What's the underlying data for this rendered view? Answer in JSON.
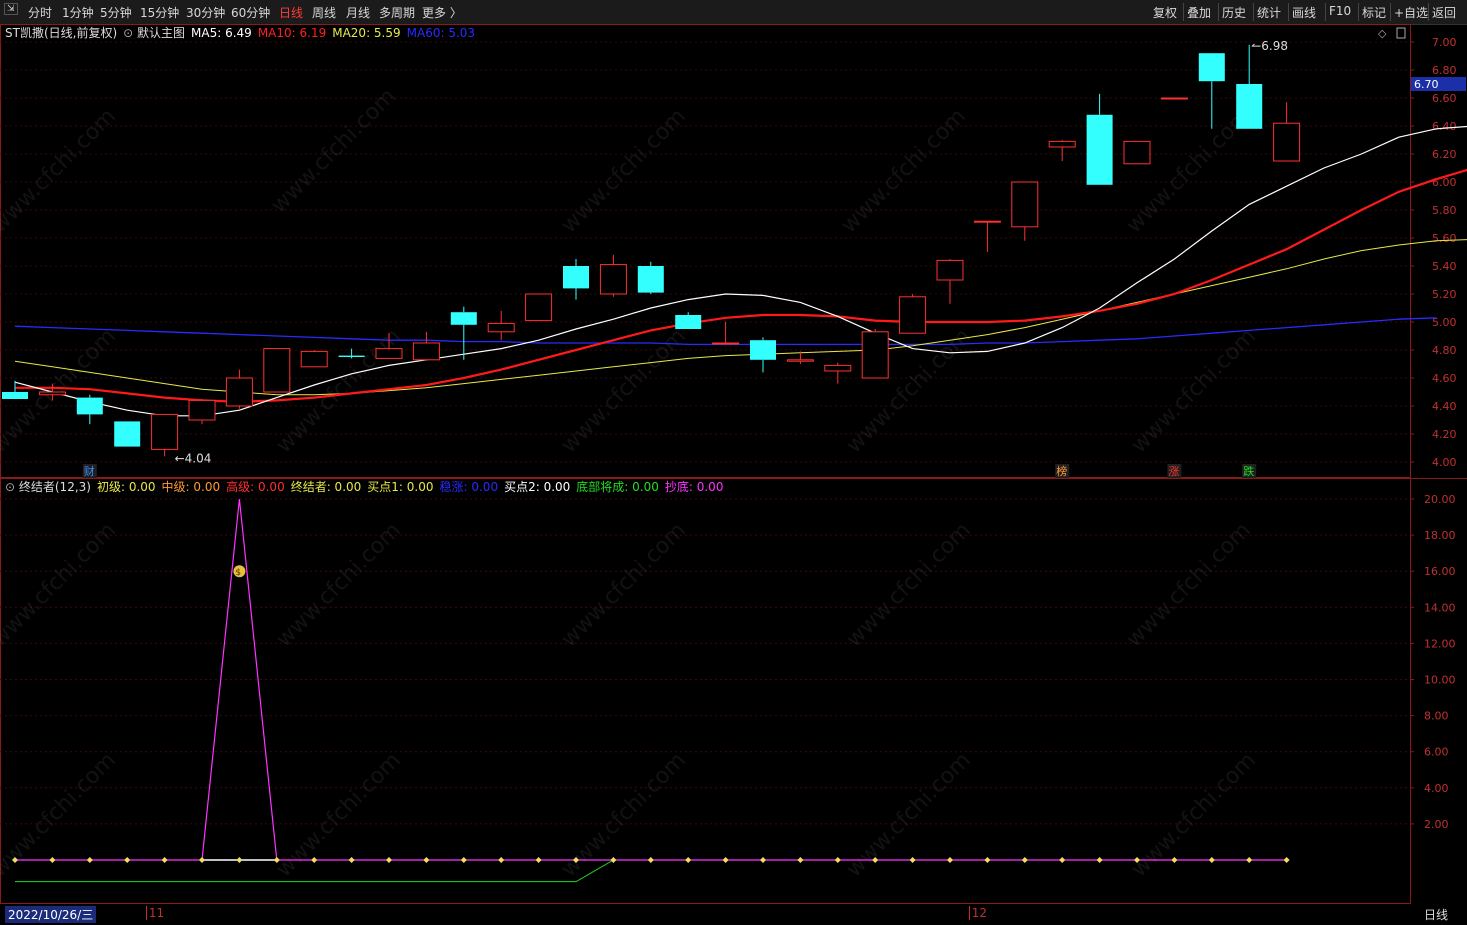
{
  "toolbar": {
    "left": [
      "分时",
      "1分钟",
      "5分钟",
      "15分钟",
      "30分钟",
      "60分钟",
      "日线",
      "周线",
      "月线",
      "多周期",
      "更多 〉"
    ],
    "active": "日线",
    "right": [
      "复权",
      "叠加",
      "历史",
      "统计",
      "画线",
      "F10",
      "标记",
      "+自选",
      "返回"
    ]
  },
  "main_header": {
    "stock": "ST凯撒(日线,前复权)",
    "template": "默认主图",
    "ma": [
      {
        "label": "MA5: 6.49",
        "color": "#ffffff"
      },
      {
        "label": "MA10: 6.19",
        "color": "#ff2020"
      },
      {
        "label": "MA20: 5.59",
        "color": "#e8e84a"
      },
      {
        "label": "MA60: 5.03",
        "color": "#2a2aff"
      }
    ]
  },
  "sub_header": {
    "name": "终结者(12,3)",
    "items": [
      {
        "label": "初级: 0.00",
        "color": "#e8e84a"
      },
      {
        "label": "中级: 0.00",
        "color": "#ff9933"
      },
      {
        "label": "高级: 0.00",
        "color": "#ff3030"
      },
      {
        "label": "终结者: 0.00",
        "color": "#e8e84a"
      },
      {
        "label": "买点1: 0.00",
        "color": "#e8e84a"
      },
      {
        "label": "稳涨: 0.00",
        "color": "#2a2aff"
      },
      {
        "label": "买点2: 0.00",
        "color": "#ffffff"
      },
      {
        "label": "底部将成: 0.00",
        "color": "#22dd22"
      },
      {
        "label": "抄底: 0.00",
        "color": "#ff33ff"
      }
    ]
  },
  "price_axis": {
    "ticks": [
      "7.00",
      "6.80",
      "6.60",
      "6.40",
      "6.20",
      "6.00",
      "5.80",
      "5.60",
      "5.40",
      "5.20",
      "5.00",
      "4.80",
      "4.60",
      "4.40",
      "4.20",
      "4.00"
    ],
    "current_price": "6.70",
    "min": 4.0,
    "max": 7.0
  },
  "sub_axis": {
    "ticks": [
      "20.00",
      "18.00",
      "16.00",
      "14.00",
      "12.00",
      "10.00",
      "8.00",
      "6.00",
      "4.00",
      "2.00"
    ],
    "min": 0,
    "max": 20
  },
  "annotations": {
    "high_label": "6.98",
    "low_label": "4.04",
    "markers": [
      {
        "text": "财",
        "color": "#3a8aff",
        "index": 2
      },
      {
        "text": "榜",
        "color": "#ff9933",
        "index": 28
      },
      {
        "text": "涨",
        "color": "#ff3030",
        "index": 31
      },
      {
        "text": "跌",
        "color": "#22dd22",
        "index": 33
      }
    ]
  },
  "bottom": {
    "date": "2022/10/26/三",
    "month_labels": [
      {
        "text": "11",
        "index": 4
      },
      {
        "text": "12",
        "index": 26
      }
    ],
    "period": "日线"
  },
  "watermark": "www.cfchi.com",
  "chart_data": {
    "type": "candlestick",
    "candles": [
      {
        "o": 4.5,
        "h": 4.58,
        "l": 4.46,
        "c": 4.45
      },
      {
        "o": 4.48,
        "h": 4.56,
        "l": 4.44,
        "c": 4.5
      },
      {
        "o": 4.46,
        "h": 4.48,
        "l": 4.27,
        "c": 4.34
      },
      {
        "o": 4.29,
        "h": 4.29,
        "l": 4.11,
        "c": 4.11
      },
      {
        "o": 4.09,
        "h": 4.34,
        "l": 4.04,
        "c": 4.34
      },
      {
        "o": 4.3,
        "h": 4.45,
        "l": 4.27,
        "c": 4.44
      },
      {
        "o": 4.4,
        "h": 4.66,
        "l": 4.38,
        "c": 4.6
      },
      {
        "o": 4.5,
        "h": 4.81,
        "l": 4.5,
        "c": 4.81
      },
      {
        "o": 4.68,
        "h": 4.8,
        "l": 4.68,
        "c": 4.79
      },
      {
        "o": 4.76,
        "h": 4.81,
        "l": 4.74,
        "c": 4.75
      },
      {
        "o": 4.74,
        "h": 4.92,
        "l": 4.74,
        "c": 4.81
      },
      {
        "o": 4.73,
        "h": 4.93,
        "l": 4.73,
        "c": 4.85
      },
      {
        "o": 5.07,
        "h": 5.11,
        "l": 4.73,
        "c": 4.98
      },
      {
        "o": 4.93,
        "h": 5.08,
        "l": 4.87,
        "c": 4.99
      },
      {
        "o": 5.01,
        "h": 5.2,
        "l": 5.01,
        "c": 5.2
      },
      {
        "o": 5.4,
        "h": 5.45,
        "l": 5.16,
        "c": 5.24
      },
      {
        "o": 5.2,
        "h": 5.48,
        "l": 5.18,
        "c": 5.41
      },
      {
        "o": 5.4,
        "h": 5.43,
        "l": 5.2,
        "c": 5.21
      },
      {
        "o": 5.05,
        "h": 5.07,
        "l": 4.95,
        "c": 4.95
      },
      {
        "o": 4.85,
        "h": 5.0,
        "l": 4.84,
        "c": 4.85
      },
      {
        "o": 4.87,
        "h": 4.89,
        "l": 4.64,
        "c": 4.73
      },
      {
        "o": 4.72,
        "h": 4.79,
        "l": 4.7,
        "c": 4.73
      },
      {
        "o": 4.65,
        "h": 4.71,
        "l": 4.56,
        "c": 4.69
      },
      {
        "o": 4.6,
        "h": 4.95,
        "l": 4.6,
        "c": 4.93
      },
      {
        "o": 4.92,
        "h": 5.2,
        "l": 4.92,
        "c": 5.18
      },
      {
        "o": 5.3,
        "h": 5.45,
        "l": 5.13,
        "c": 5.44
      },
      {
        "o": 5.72,
        "h": 5.72,
        "l": 5.5,
        "c": 5.72
      },
      {
        "o": 5.68,
        "h": 6.0,
        "l": 5.58,
        "c": 6.0
      },
      {
        "o": 6.25,
        "h": 6.3,
        "l": 6.15,
        "c": 6.29
      },
      {
        "o": 6.48,
        "h": 6.63,
        "l": 5.98,
        "c": 5.98
      },
      {
        "o": 6.13,
        "h": 6.29,
        "l": 6.13,
        "c": 6.29
      },
      {
        "o": 6.6,
        "h": 6.6,
        "l": 6.6,
        "c": 6.6
      },
      {
        "o": 6.92,
        "h": 6.92,
        "l": 6.38,
        "c": 6.72
      },
      {
        "o": 6.7,
        "h": 6.98,
        "l": 6.38,
        "c": 6.38
      },
      {
        "o": 6.15,
        "h": 6.57,
        "l": 6.15,
        "c": 6.42
      }
    ],
    "ma5": [
      4.57,
      4.5,
      4.43,
      4.37,
      4.33,
      4.33,
      4.37,
      4.46,
      4.55,
      4.63,
      4.69,
      4.73,
      4.77,
      4.81,
      4.87,
      4.95,
      5.02,
      5.1,
      5.16,
      5.2,
      5.19,
      5.14,
      5.04,
      4.92,
      4.81,
      4.78,
      4.79,
      4.85,
      4.96,
      5.1,
      5.28,
      5.45,
      5.65,
      5.84,
      5.97,
      6.1,
      6.2,
      6.32,
      6.38,
      6.4,
      6.49
    ],
    "ma10": [
      4.53,
      4.53,
      4.52,
      4.49,
      4.46,
      4.44,
      4.43,
      4.44,
      4.46,
      4.49,
      4.52,
      4.55,
      4.6,
      4.66,
      4.73,
      4.8,
      4.87,
      4.94,
      4.99,
      5.03,
      5.05,
      5.05,
      5.04,
      5.01,
      5.0,
      5.0,
      5.0,
      5.01,
      5.04,
      5.08,
      5.13,
      5.2,
      5.3,
      5.41,
      5.52,
      5.66,
      5.8,
      5.93,
      6.02,
      6.1,
      6.19
    ],
    "ma20": [
      4.72,
      4.68,
      4.64,
      4.6,
      4.56,
      4.52,
      4.5,
      4.48,
      4.48,
      4.49,
      4.51,
      4.53,
      4.56,
      4.59,
      4.62,
      4.65,
      4.68,
      4.71,
      4.74,
      4.76,
      4.77,
      4.78,
      4.79,
      4.8,
      4.83,
      4.87,
      4.91,
      4.96,
      5.02,
      5.08,
      5.14,
      5.2,
      5.26,
      5.32,
      5.38,
      5.45,
      5.51,
      5.55,
      5.58,
      5.59
    ],
    "ma60": [
      4.97,
      4.96,
      4.95,
      4.94,
      4.93,
      4.92,
      4.91,
      4.9,
      4.89,
      4.88,
      4.87,
      4.87,
      4.86,
      4.86,
      4.85,
      4.85,
      4.85,
      4.85,
      4.84,
      4.84,
      4.84,
      4.84,
      4.84,
      4.84,
      4.84,
      4.84,
      4.85,
      4.85,
      4.86,
      4.87,
      4.88,
      4.9,
      4.92,
      4.94,
      4.96,
      4.98,
      5.0,
      5.02,
      5.03
    ],
    "indicator": {
      "spike_index": 6,
      "spike_value": 20,
      "green_line_start": -1.2,
      "green_line_rise_from": 15,
      "green_line_rise_to": 16
    }
  }
}
